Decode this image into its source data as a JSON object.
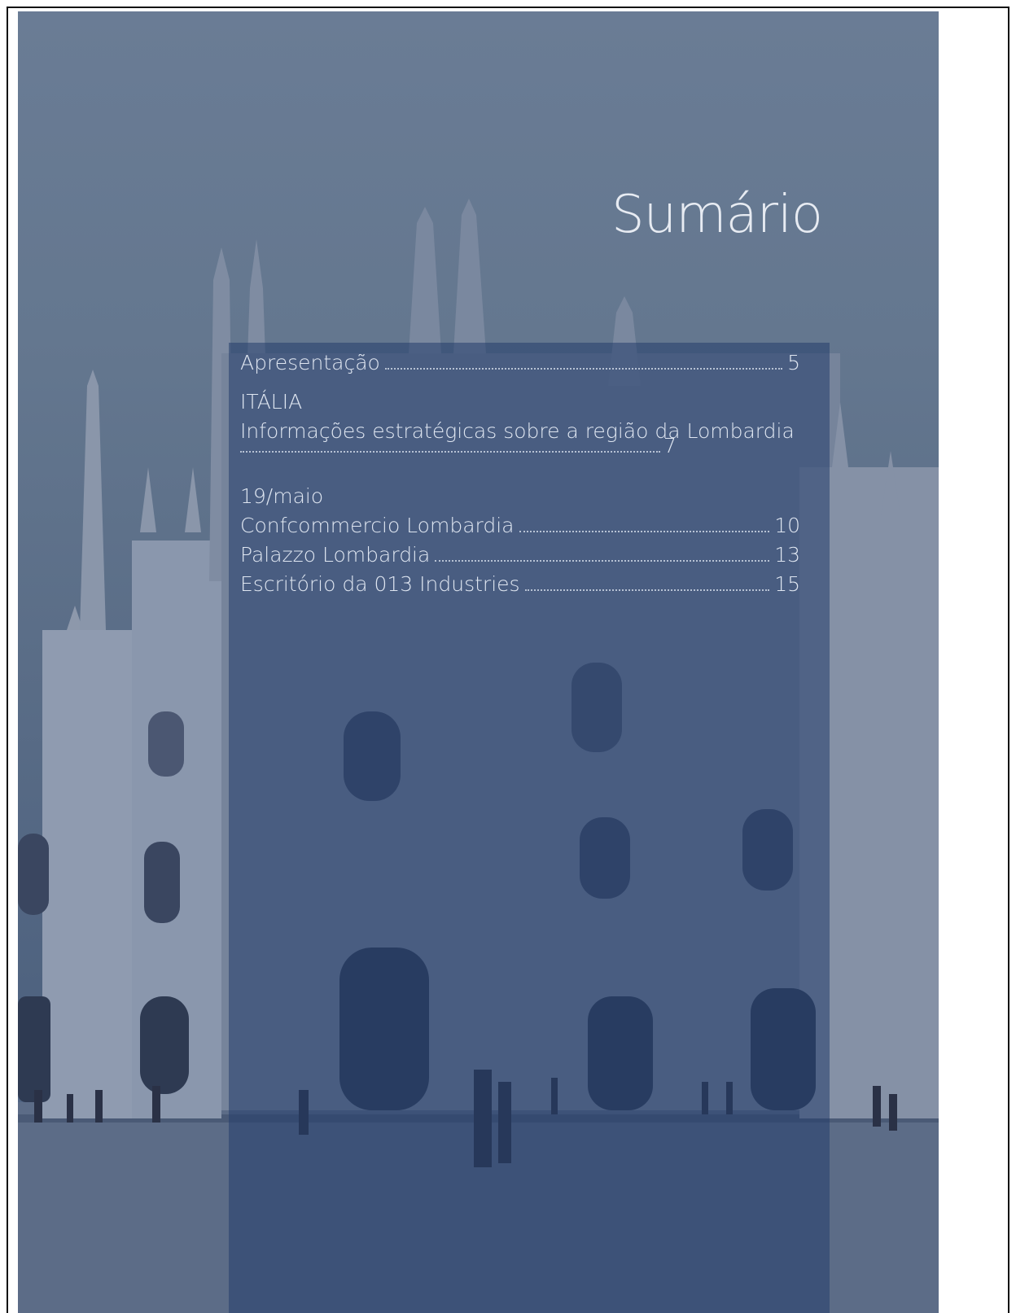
{
  "page": {
    "title": "Sumário"
  },
  "toc": {
    "items": [
      {
        "label": "Apresentação",
        "page": "5"
      },
      {
        "label": "ITÁLIA"
      },
      {
        "label": "Informações estratégicas sobre a região da Lombardia",
        "page": "7"
      },
      {
        "label": "19/maio"
      },
      {
        "label": "Confcommercio Lombardia",
        "page": "10"
      },
      {
        "label": "Palazzo Lombardia",
        "page": "13"
      },
      {
        "label": "Escritório da 013 Industries",
        "page": "15"
      }
    ]
  },
  "colors": {
    "overlay": "#243e6c",
    "text": "#dfe6f1",
    "sky": "#6a7c95"
  }
}
